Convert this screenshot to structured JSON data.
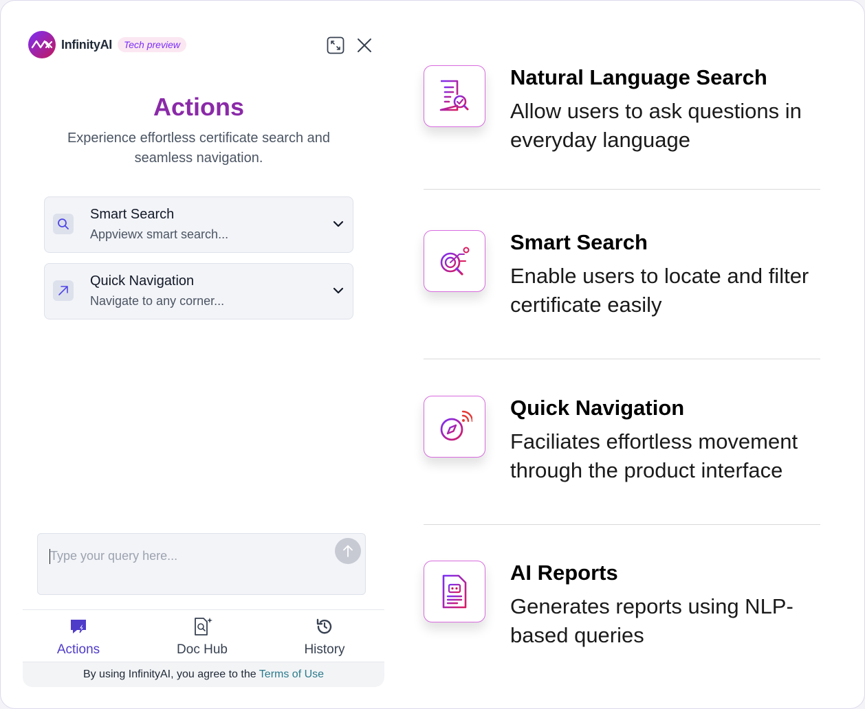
{
  "app": {
    "brand": "InfinityAI",
    "badge": "Tech preview"
  },
  "hero": {
    "title": "Actions",
    "subtitle": "Experience effortless certificate search and seamless navigation."
  },
  "actions": [
    {
      "title": "Smart Search",
      "subtitle": "Appviewx smart search...",
      "icon": "magnifier-icon"
    },
    {
      "title": "Quick Navigation",
      "subtitle": "Navigate to any corner...",
      "icon": "arrow-up-right-icon"
    }
  ],
  "query": {
    "placeholder": "Type your query here..."
  },
  "nav": [
    {
      "label": "Actions",
      "icon": "chat-bolt-icon",
      "active": true
    },
    {
      "label": "Doc Hub",
      "icon": "doc-search-icon",
      "active": false
    },
    {
      "label": "History",
      "icon": "history-icon",
      "active": false
    }
  ],
  "footer": {
    "prefix": "By using InfinityAI, you agree to the",
    "link": "Terms of Use"
  },
  "features": [
    {
      "title": "Natural Language Search",
      "desc": "Allow users to ask questions in everyday language",
      "icon": "document-check-icon"
    },
    {
      "title": "Smart Search",
      "desc": "Enable users to locate and filter certificate easily",
      "icon": "target-search-icon"
    },
    {
      "title": "Quick Navigation",
      "desc": "Faciliates effortless movement through the product interface",
      "icon": "compass-icon"
    },
    {
      "title": "AI Reports",
      "desc": "Generates reports using NLP-based queries",
      "icon": "robot-report-icon"
    }
  ],
  "colors": {
    "accent_purple": "#7b2ff7",
    "accent_magenta": "#c2185b",
    "title_purple": "#8a2aa8",
    "nav_active": "#4f3cc9",
    "link": "#2b7a8c"
  }
}
